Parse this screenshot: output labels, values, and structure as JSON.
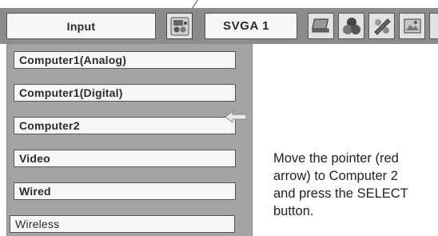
{
  "menu_bar": {
    "input_label": "Input",
    "mode_label": "SVGA 1",
    "icons": [
      "input-source-icon",
      "screen-icon",
      "color-adjust-icon",
      "image-adjust-icon",
      "image-picture-icon",
      "more-icon"
    ]
  },
  "input_list": {
    "items": [
      {
        "label": "Computer1(Analog)"
      },
      {
        "label": "Computer1(Digital)"
      },
      {
        "label": "Computer2",
        "pointed": true
      },
      {
        "label": "Video"
      },
      {
        "label": "Wired"
      },
      {
        "label": "Wireless"
      }
    ],
    "pointer_icon": "pointer-arrow-left-icon"
  },
  "caption": {
    "lines": [
      "Move the pointer (red",
      "arrow) to Computer 2",
      "and press the SELECT",
      "button."
    ]
  }
}
